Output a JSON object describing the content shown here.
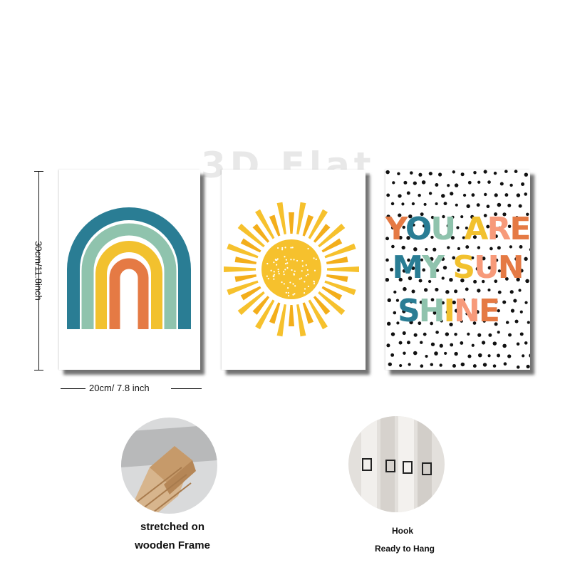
{
  "watermark": "3D Flat",
  "dimensions": {
    "height_label": "30cm/11.8inch",
    "width_label": "20cm/ 7.8 inch"
  },
  "panels": [
    {
      "subject": "rainbow-art",
      "colors": [
        "#2a7d94",
        "#8fc3ad",
        "#f2c12e",
        "#e57a44"
      ]
    },
    {
      "subject": "sun-art",
      "colors": [
        "#f6c12d",
        "#f3ae1b"
      ]
    },
    {
      "subject": "text-art",
      "lines": [
        "YOU ARE",
        "MY SUN",
        "SHINE"
      ],
      "letter_colors": [
        "#e57a44",
        "#2a7d94",
        "#8fc3ad",
        "#f2c12e",
        "#f79a7a"
      ]
    }
  ],
  "details": [
    {
      "caption_line1": "stretched on",
      "caption_line2": "wooden Frame"
    },
    {
      "caption_line1": "Hook",
      "caption_line2": "Ready to Hang"
    }
  ]
}
